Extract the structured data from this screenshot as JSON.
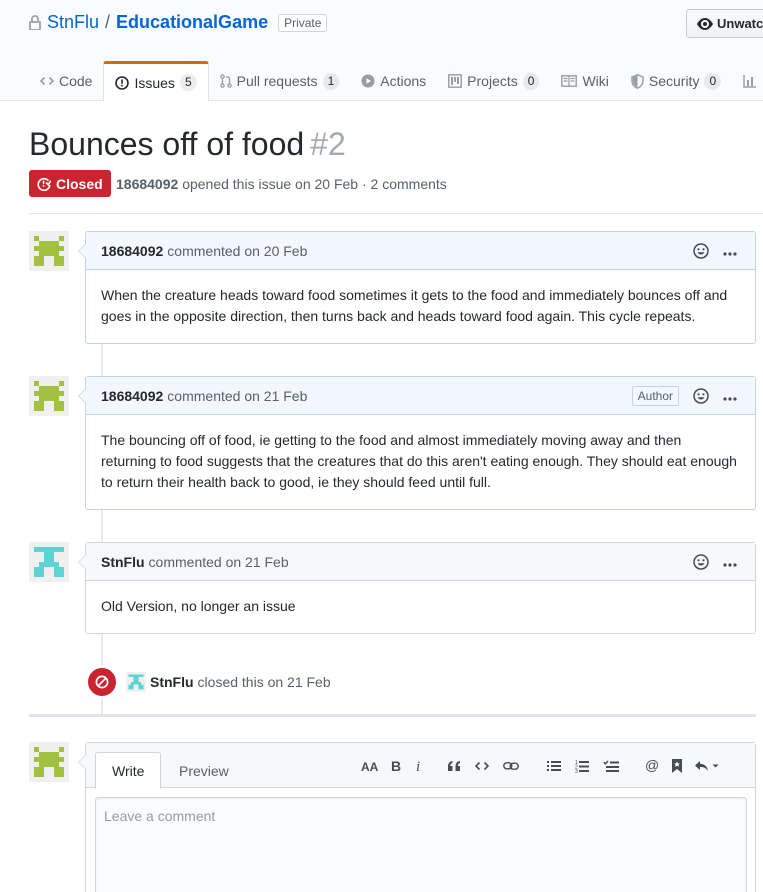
{
  "repo": {
    "owner": "StnFlu",
    "separator": "/",
    "name": "EducationalGame",
    "visibility": "Private",
    "watch_label": "Unwatch"
  },
  "nav": {
    "tabs": [
      {
        "label": "Code",
        "icon": "code-icon"
      },
      {
        "label": "Issues",
        "count": "5",
        "icon": "issue-opened-icon",
        "selected": true
      },
      {
        "label": "Pull requests",
        "count": "1",
        "icon": "git-pull-request-icon"
      },
      {
        "label": "Actions",
        "icon": "play-icon"
      },
      {
        "label": "Projects",
        "count": "0",
        "icon": "project-icon"
      },
      {
        "label": "Wiki",
        "icon": "book-icon"
      },
      {
        "label": "Security",
        "count": "0",
        "icon": "shield-icon"
      }
    ]
  },
  "issue": {
    "title": "Bounces off of food",
    "number": "#2",
    "status": "Closed",
    "status_color": "#cb2431",
    "opener": "18684092",
    "meta_text": "opened this issue on 20 Feb · 2 comments"
  },
  "comments": [
    {
      "author": "18684092",
      "when": "commented on 20 Feb",
      "body": "When the creature heads toward food sometimes it gets to the food and immediately bounces off and goes in the opposite direction, then turns back and heads toward food again. This cycle repeats."
    },
    {
      "author": "18684092",
      "when": "commented on 21 Feb",
      "author_badge": "Author",
      "body": "The bouncing off of food, ie getting to the food and almost immediately moving away and then returning to food suggests that the creatures that do this aren't eating enough. They should eat enough to return their health back to good, ie they should feed until full."
    },
    {
      "author": "StnFlu",
      "when": "commented on 21 Feb",
      "body": "Old Version, no longer an issue"
    }
  ],
  "event": {
    "actor": "StnFlu",
    "text": "closed this on 21 Feb"
  },
  "new_comment": {
    "write_tab": "Write",
    "preview_tab": "Preview",
    "placeholder": "Leave a comment",
    "toolbar": [
      "header-icon",
      "bold-icon",
      "italic-icon",
      "quote-icon",
      "code-icon",
      "link-icon",
      "unordered-list-icon",
      "ordered-list-icon",
      "task-list-icon",
      "mention-icon",
      "bookmark-icon",
      "reply-icon"
    ]
  },
  "colors": {
    "link": "#0366d6",
    "closed": "#cb2431",
    "avatar_green": "#a2c13e",
    "avatar_cyan": "#5ed3d3"
  }
}
